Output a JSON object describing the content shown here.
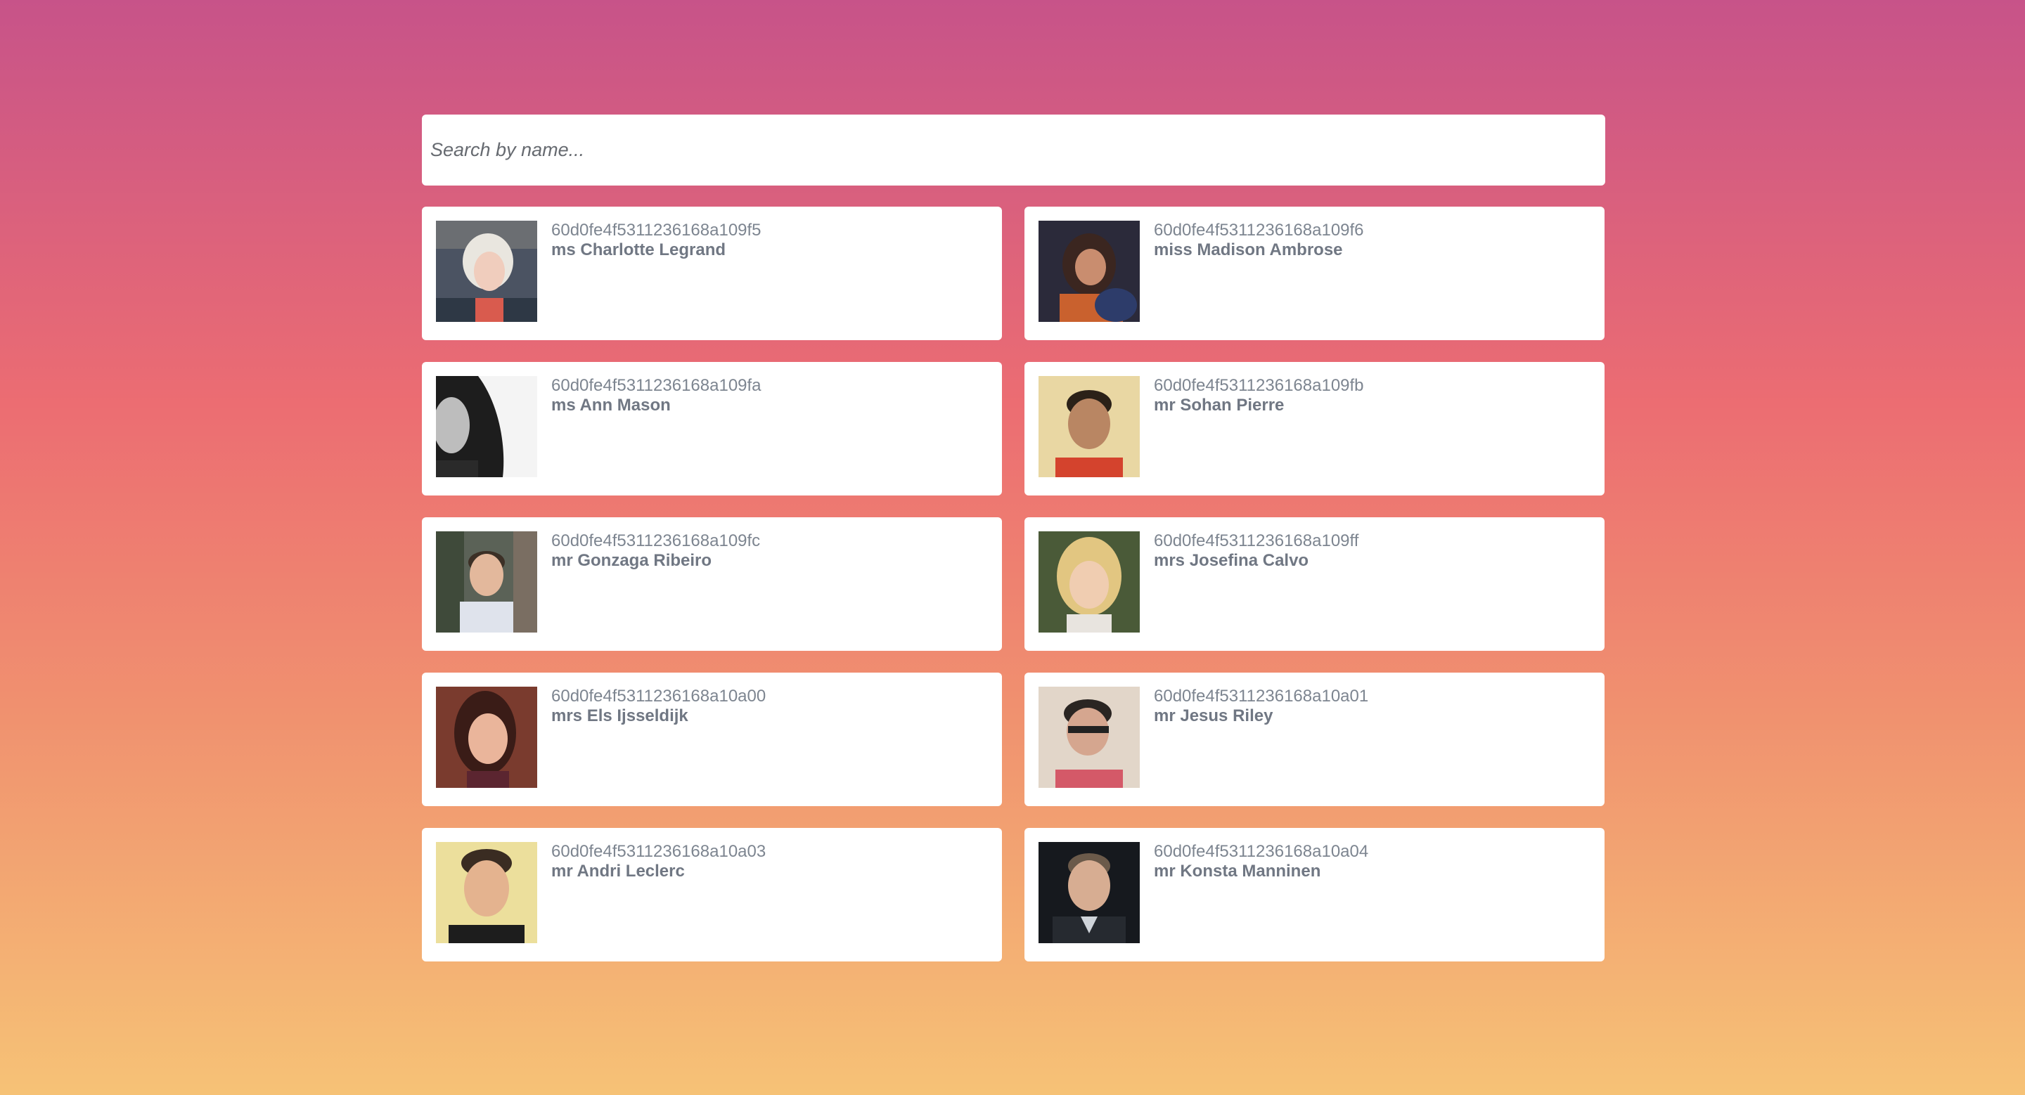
{
  "search": {
    "placeholder": "Search by name..."
  },
  "users": [
    {
      "id": "60d0fe4f5311236168a109f5",
      "name": "ms Charlotte Legrand"
    },
    {
      "id": "60d0fe4f5311236168a109f6",
      "name": "miss Madison Ambrose"
    },
    {
      "id": "60d0fe4f5311236168a109fa",
      "name": "ms Ann Mason"
    },
    {
      "id": "60d0fe4f5311236168a109fb",
      "name": "mr Sohan Pierre"
    },
    {
      "id": "60d0fe4f5311236168a109fc",
      "name": "mr Gonzaga Ribeiro"
    },
    {
      "id": "60d0fe4f5311236168a109ff",
      "name": "mrs Josefina Calvo"
    },
    {
      "id": "60d0fe4f5311236168a10a00",
      "name": "mrs Els Ijsseldijk"
    },
    {
      "id": "60d0fe4f5311236168a10a01",
      "name": "mr Jesus Riley"
    },
    {
      "id": "60d0fe4f5311236168a10a03",
      "name": "mr Andri Leclerc"
    },
    {
      "id": "60d0fe4f5311236168a10a04",
      "name": "mr Konsta Manninen"
    }
  ],
  "colors": {
    "gradient_top": "#c75389",
    "gradient_mid": "#ec6d72",
    "gradient_bottom": "#f6c276",
    "id_text": "#7d8590",
    "name_text": "#707783"
  }
}
